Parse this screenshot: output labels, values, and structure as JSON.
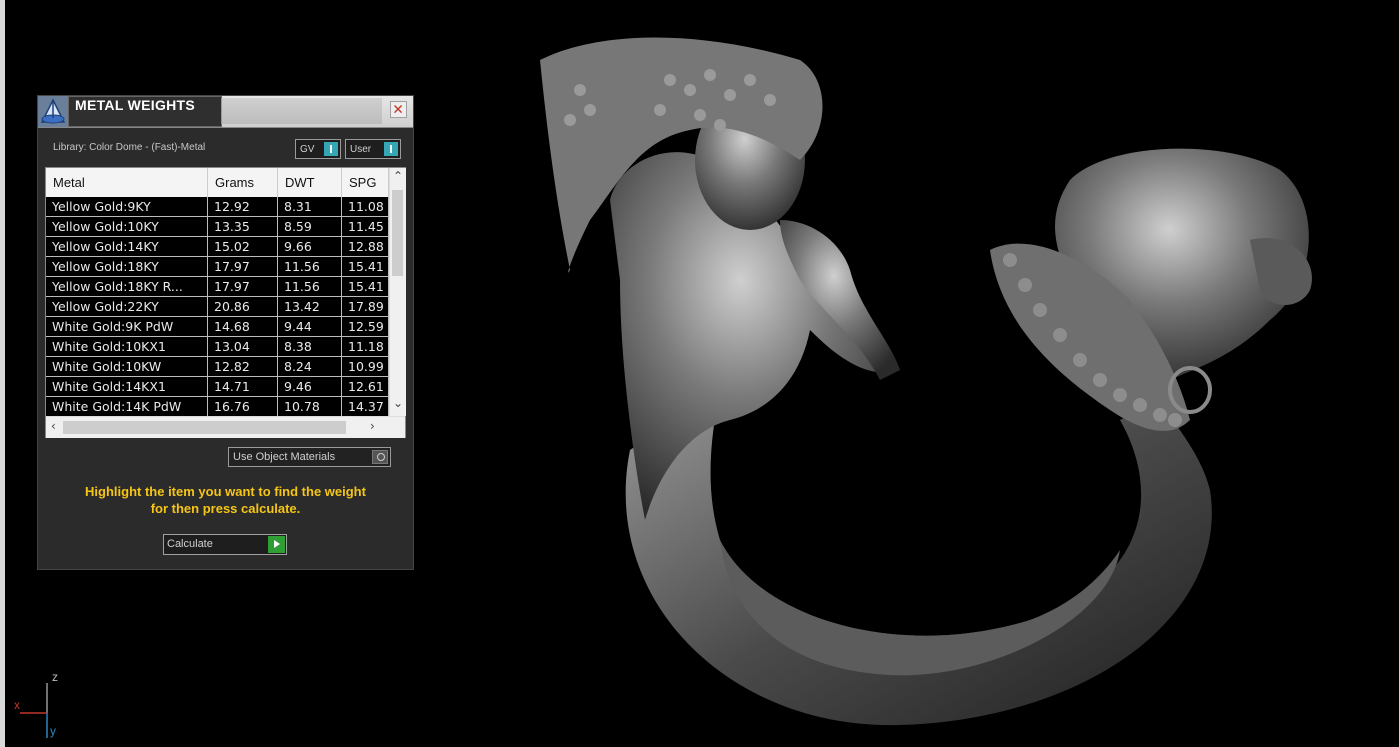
{
  "panel": {
    "title": "METAL WEIGHTS",
    "library_label": "Library: Color Dome - (Fast)-Metal",
    "toggles": [
      {
        "label": "GV"
      },
      {
        "label": "User"
      }
    ],
    "table": {
      "columns": [
        "Metal",
        "Grams",
        "DWT",
        "SPG"
      ],
      "rows": [
        [
          "Yellow Gold:9KY",
          "12.92",
          "8.31",
          "11.08"
        ],
        [
          "Yellow Gold:10KY",
          "13.35",
          "8.59",
          "11.45"
        ],
        [
          "Yellow Gold:14KY",
          "15.02",
          "9.66",
          "12.88"
        ],
        [
          "Yellow Gold:18KY",
          "17.97",
          "11.56",
          "15.41"
        ],
        [
          "Yellow Gold:18KY R...",
          "17.97",
          "11.56",
          "15.41"
        ],
        [
          "Yellow Gold:22KY",
          "20.86",
          "13.42",
          "17.89"
        ],
        [
          "White Gold:9K PdW",
          "14.68",
          "9.44",
          "12.59"
        ],
        [
          "White Gold:10KX1",
          "13.04",
          "8.38",
          "11.18"
        ],
        [
          "White Gold:10KW",
          "12.82",
          "8.24",
          "10.99"
        ],
        [
          "White Gold:14KX1",
          "14.71",
          "9.46",
          "12.61"
        ],
        [
          "White Gold:14K PdW",
          "16.76",
          "10.78",
          "14.37"
        ]
      ]
    },
    "use_object_materials_label": "Use Object Materials",
    "instruction_line1": "Highlight the item you want to find the weight",
    "instruction_line2": "for then press calculate.",
    "calculate_label": "Calculate"
  },
  "axis": {
    "x": "x",
    "y": "y",
    "z": "z"
  },
  "colors": {
    "background": "#000000",
    "instruction": "#f5c518",
    "toggle_accent": "#35a6b4",
    "calculate_accent": "#2f9e35",
    "axis_x": "#c0392b",
    "axis_y": "#2e86c1",
    "axis_z": "#bdbdbd"
  },
  "viewport": {
    "model": "ring-3d-model"
  }
}
